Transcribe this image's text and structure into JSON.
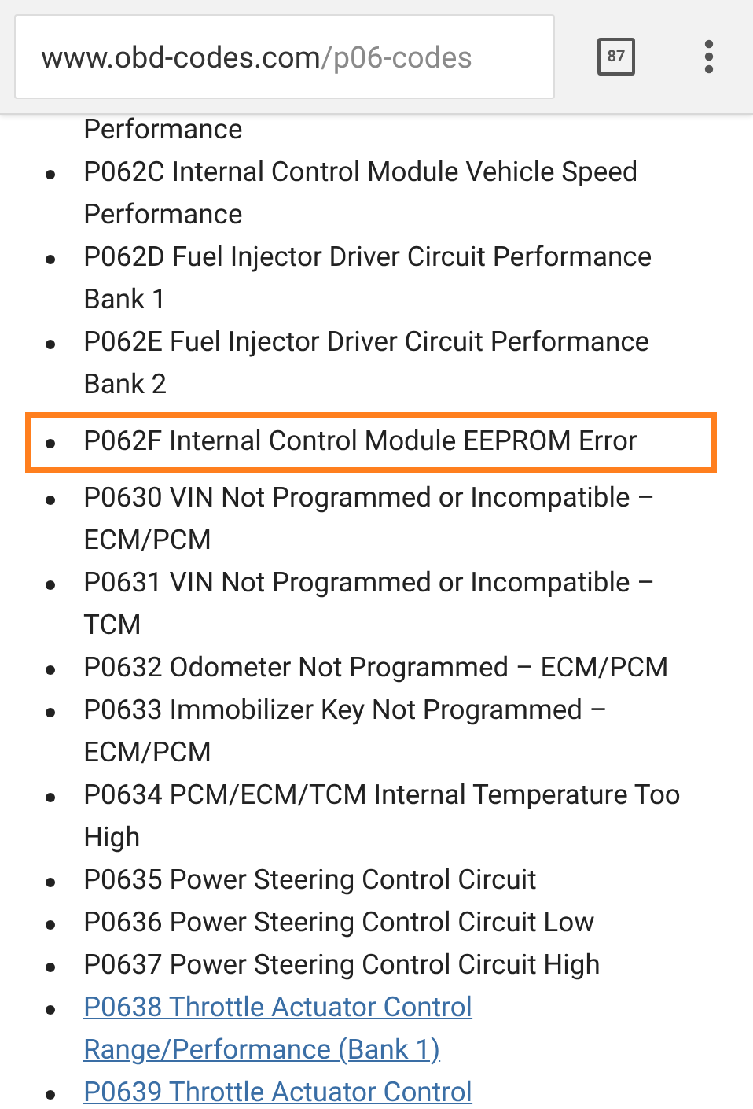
{
  "toolbar": {
    "url_host": "www.obd-codes.com",
    "url_path": "/p06-codes",
    "tab_count": "87"
  },
  "top_fragment": "Performance",
  "items": [
    {
      "kind": "text",
      "highlighted": false,
      "lines": [
        "P062C Internal Control Module Vehicle Speed",
        "Performance"
      ]
    },
    {
      "kind": "text",
      "highlighted": false,
      "lines": [
        "P062D Fuel Injector Driver Circuit Performance",
        "Bank 1"
      ]
    },
    {
      "kind": "text",
      "highlighted": false,
      "lines": [
        "P062E Fuel Injector Driver Circuit Performance",
        "Bank 2"
      ]
    },
    {
      "kind": "text",
      "highlighted": true,
      "lines": [
        "P062F Internal Control Module EEPROM Error"
      ]
    },
    {
      "kind": "text",
      "highlighted": false,
      "lines": [
        "P0630 VIN Not Programmed or Incompatible –",
        "ECM/PCM"
      ]
    },
    {
      "kind": "text",
      "highlighted": false,
      "lines": [
        "P0631 VIN Not Programmed or Incompatible –",
        "TCM"
      ]
    },
    {
      "kind": "text",
      "highlighted": false,
      "lines": [
        "P0632 Odometer Not Programmed – ECM/PCM"
      ]
    },
    {
      "kind": "text",
      "highlighted": false,
      "lines": [
        "P0633 Immobilizer Key Not Programmed –",
        "ECM/PCM"
      ]
    },
    {
      "kind": "text",
      "highlighted": false,
      "lines": [
        "P0634 PCM/ECM/TCM Internal Temperature Too",
        "High"
      ]
    },
    {
      "kind": "text",
      "highlighted": false,
      "lines": [
        "P0635 Power Steering Control Circuit"
      ]
    },
    {
      "kind": "text",
      "highlighted": false,
      "lines": [
        "P0636 Power Steering Control Circuit Low"
      ]
    },
    {
      "kind": "text",
      "highlighted": false,
      "lines": [
        "P0637 Power Steering Control Circuit High"
      ]
    },
    {
      "kind": "link",
      "highlighted": false,
      "lines": [
        "P0638 Throttle Actuator Control",
        "Range/Performance (Bank 1)"
      ]
    },
    {
      "kind": "link",
      "highlighted": false,
      "lines": [
        "P0639 Throttle Actuator Control"
      ]
    }
  ]
}
